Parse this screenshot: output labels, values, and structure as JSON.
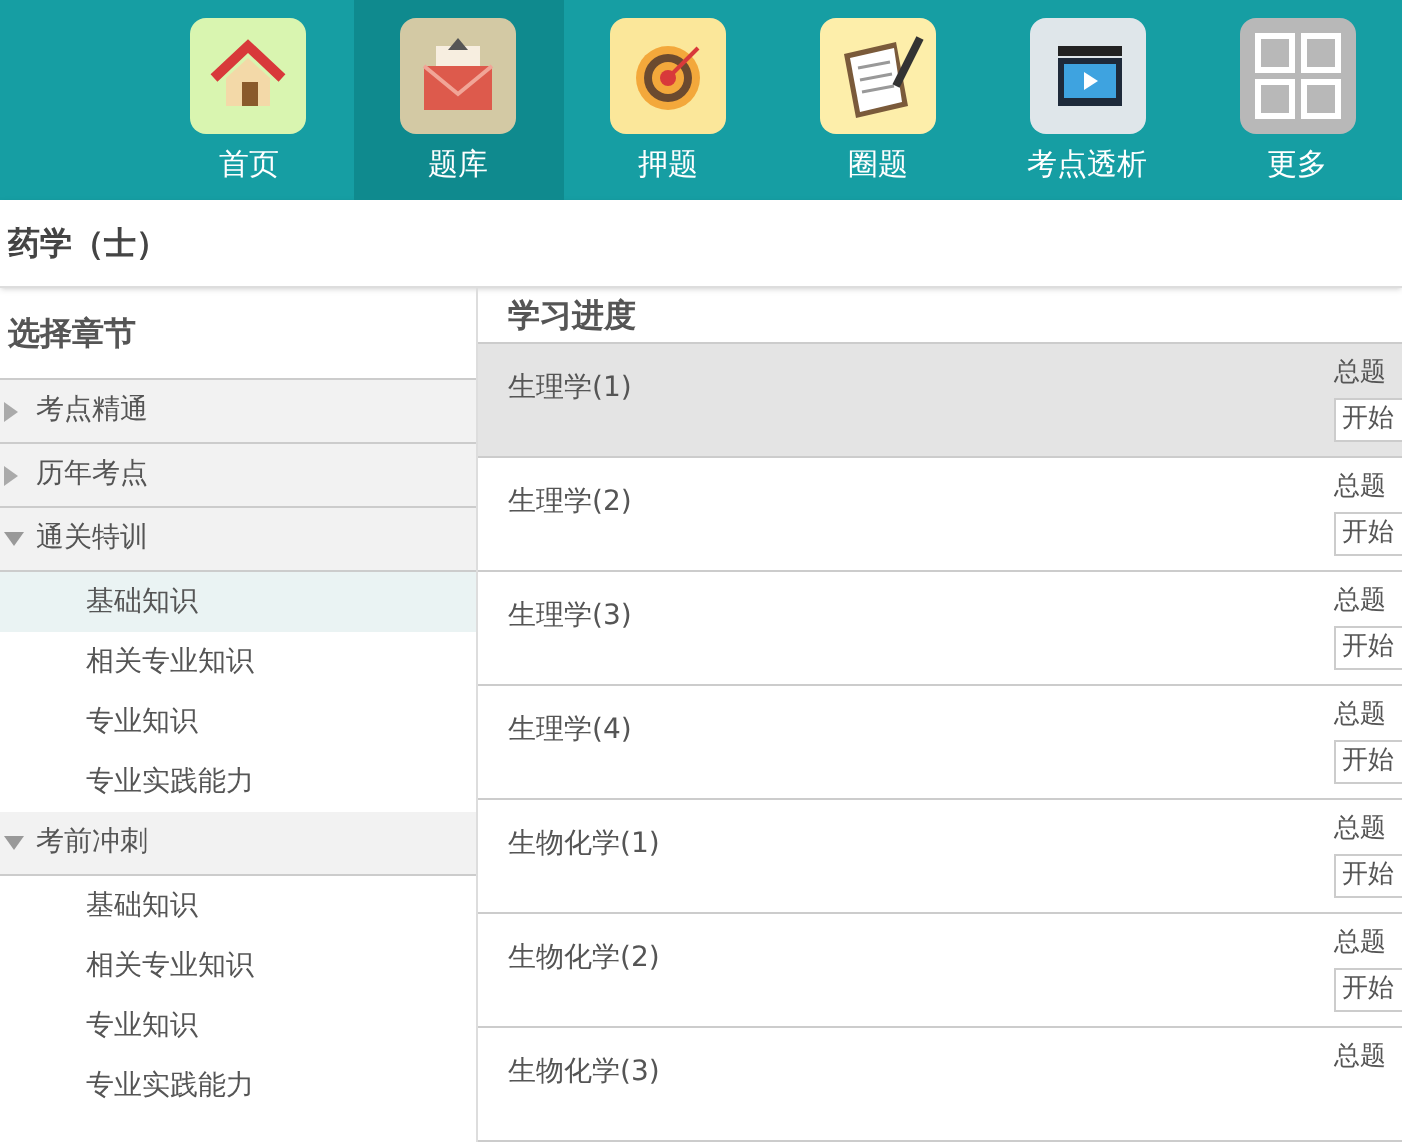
{
  "nav": [
    {
      "label": "首页",
      "kind": "home",
      "selected": false
    },
    {
      "label": "题库",
      "kind": "mail",
      "selected": true
    },
    {
      "label": "押题",
      "kind": "target",
      "selected": false
    },
    {
      "label": "圈题",
      "kind": "clipboard",
      "selected": false
    },
    {
      "label": "考点透析",
      "kind": "video",
      "selected": false
    },
    {
      "label": "更多",
      "kind": "grid",
      "selected": false
    }
  ],
  "page_title": "药学（士）",
  "sidebar": {
    "title": "选择章节",
    "items": [
      {
        "label": "考点精通",
        "expanded": false
      },
      {
        "label": "历年考点",
        "expanded": false
      },
      {
        "label": "通关特训",
        "expanded": true,
        "children": [
          {
            "label": "基础知识",
            "selected": true
          },
          {
            "label": "相关专业知识",
            "selected": false
          },
          {
            "label": "专业知识",
            "selected": false
          },
          {
            "label": "专业实践能力",
            "selected": false
          }
        ]
      },
      {
        "label": "考前冲刺",
        "expanded": true,
        "children": [
          {
            "label": "基础知识",
            "selected": false
          },
          {
            "label": "相关专业知识",
            "selected": false
          },
          {
            "label": "专业知识",
            "selected": false
          },
          {
            "label": "专业实践能力",
            "selected": false
          }
        ]
      }
    ]
  },
  "progress": {
    "title": "学习进度",
    "rows": [
      {
        "name": "生理学(1)",
        "total": "总题",
        "button": "开始",
        "selected": true
      },
      {
        "name": "生理学(2)",
        "total": "总题",
        "button": "开始",
        "selected": false
      },
      {
        "name": "生理学(3)",
        "total": "总题",
        "button": "开始",
        "selected": false
      },
      {
        "name": "生理学(4)",
        "total": "总题",
        "button": "开始",
        "selected": false
      },
      {
        "name": "生物化学(1)",
        "total": "总题",
        "button": "开始",
        "selected": false
      },
      {
        "name": "生物化学(2)",
        "total": "总题",
        "button": "开始",
        "selected": false
      },
      {
        "name": "生物化学(3)",
        "total": "总题",
        "selected": false
      }
    ]
  }
}
